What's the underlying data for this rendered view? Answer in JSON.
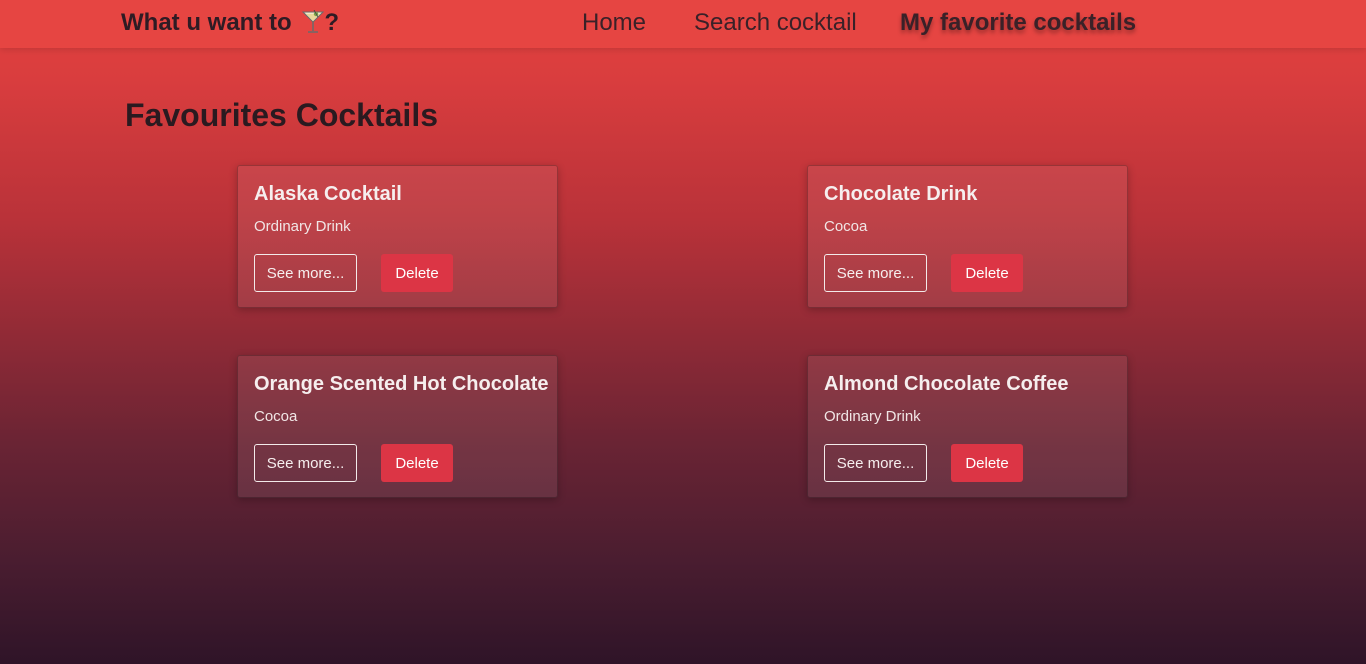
{
  "navbar": {
    "brand_text": "What u want to",
    "brand_suffix": "?",
    "brand_icon": "cocktail-glass-icon",
    "links": {
      "home": "Home",
      "search": "Search cocktail",
      "favorites": "My favorite cocktails"
    }
  },
  "page": {
    "title": "Favourites Cocktails"
  },
  "cards": [
    {
      "name": "Alaska Cocktail",
      "category": "Ordinary Drink",
      "see_more": "See more...",
      "delete": "Delete"
    },
    {
      "name": "Chocolate Drink",
      "category": "Cocoa",
      "see_more": "See more...",
      "delete": "Delete"
    },
    {
      "name": "Orange Scented Hot Chocolate",
      "category": "Cocoa",
      "see_more": "See more...",
      "delete": "Delete"
    },
    {
      "name": "Almond Chocolate Coffee",
      "category": "Ordinary Drink",
      "see_more": "See more...",
      "delete": "Delete"
    }
  ],
  "colors": {
    "navbar": "#e64542",
    "delete_button": "#dc3545",
    "gradient_top": "#e4423f",
    "gradient_bottom": "#2f1428"
  }
}
